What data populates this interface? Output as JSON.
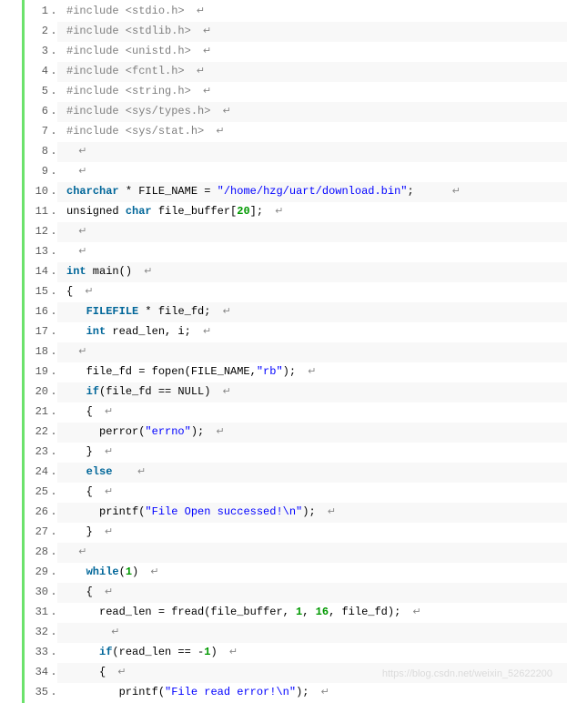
{
  "watermark": "https://blog.csdn.net/weixin_52622200",
  "return_glyph": "↵",
  "lines": [
    {
      "n": 1,
      "tokens": [
        {
          "t": "#include <stdio.h>",
          "c": "pp"
        }
      ]
    },
    {
      "n": 2,
      "tokens": [
        {
          "t": "#include <stdlib.h>",
          "c": "pp"
        }
      ]
    },
    {
      "n": 3,
      "tokens": [
        {
          "t": "#include <unistd.h>",
          "c": "pp"
        }
      ]
    },
    {
      "n": 4,
      "tokens": [
        {
          "t": "#include <fcntl.h>",
          "c": "pp"
        }
      ]
    },
    {
      "n": 5,
      "tokens": [
        {
          "t": "#include <string.h>",
          "c": "pp"
        }
      ]
    },
    {
      "n": 6,
      "tokens": [
        {
          "t": "#include <sys/types.h>",
          "c": "pp"
        }
      ]
    },
    {
      "n": 7,
      "tokens": [
        {
          "t": "#include <sys/stat.h>",
          "c": "pp"
        }
      ]
    },
    {
      "n": 8,
      "tokens": []
    },
    {
      "n": 9,
      "tokens": []
    },
    {
      "n": 10,
      "tokens": [
        {
          "t": "char",
          "c": "kw"
        },
        {
          "t": "char",
          "c": "kw"
        },
        {
          "t": " * FILE_NAME = ",
          "c": ""
        },
        {
          "t": "\"/home/hzg/uart/download.bin\"",
          "c": "str"
        },
        {
          "t": ";    ",
          "c": ""
        }
      ]
    },
    {
      "n": 11,
      "tokens": [
        {
          "t": "unsigned ",
          "c": ""
        },
        {
          "t": "char",
          "c": "kw"
        },
        {
          "t": " file_buffer[",
          "c": ""
        },
        {
          "t": "20",
          "c": "num"
        },
        {
          "t": "];",
          "c": ""
        }
      ]
    },
    {
      "n": 12,
      "tokens": []
    },
    {
      "n": 13,
      "tokens": []
    },
    {
      "n": 14,
      "tokens": [
        {
          "t": "int",
          "c": "kw"
        },
        {
          "t": " main()",
          "c": ""
        }
      ]
    },
    {
      "n": 15,
      "tokens": [
        {
          "t": "{",
          "c": ""
        }
      ]
    },
    {
      "n": 16,
      "tokens": [
        {
          "t": "   ",
          "c": ""
        },
        {
          "t": "FILE",
          "c": "kw"
        },
        {
          "t": "FILE",
          "c": "kw"
        },
        {
          "t": " * file_fd;",
          "c": ""
        }
      ]
    },
    {
      "n": 17,
      "tokens": [
        {
          "t": "   ",
          "c": ""
        },
        {
          "t": "int",
          "c": "kw"
        },
        {
          "t": " read_len, i;",
          "c": ""
        }
      ]
    },
    {
      "n": 18,
      "tokens": []
    },
    {
      "n": 19,
      "tokens": [
        {
          "t": "   file_fd = fopen(FILE_NAME,",
          "c": ""
        },
        {
          "t": "\"rb\"",
          "c": "str"
        },
        {
          "t": ");",
          "c": ""
        }
      ]
    },
    {
      "n": 20,
      "tokens": [
        {
          "t": "   ",
          "c": ""
        },
        {
          "t": "if",
          "c": "kw"
        },
        {
          "t": "(file_fd == NULL)",
          "c": ""
        }
      ]
    },
    {
      "n": 21,
      "tokens": [
        {
          "t": "   {",
          "c": ""
        }
      ]
    },
    {
      "n": 22,
      "tokens": [
        {
          "t": "     perror(",
          "c": ""
        },
        {
          "t": "\"errno\"",
          "c": "str"
        },
        {
          "t": ");",
          "c": ""
        }
      ]
    },
    {
      "n": 23,
      "tokens": [
        {
          "t": "   }",
          "c": ""
        }
      ]
    },
    {
      "n": 24,
      "tokens": [
        {
          "t": "   ",
          "c": ""
        },
        {
          "t": "else",
          "c": "kw"
        },
        {
          "t": "  ",
          "c": ""
        }
      ]
    },
    {
      "n": 25,
      "tokens": [
        {
          "t": "   {",
          "c": ""
        }
      ]
    },
    {
      "n": 26,
      "tokens": [
        {
          "t": "     printf(",
          "c": ""
        },
        {
          "t": "\"File Open successed!\\n\"",
          "c": "str"
        },
        {
          "t": ");",
          "c": ""
        }
      ]
    },
    {
      "n": 27,
      "tokens": [
        {
          "t": "   }",
          "c": ""
        }
      ]
    },
    {
      "n": 28,
      "tokens": []
    },
    {
      "n": 29,
      "tokens": [
        {
          "t": "   ",
          "c": ""
        },
        {
          "t": "while",
          "c": "kw"
        },
        {
          "t": "(",
          "c": ""
        },
        {
          "t": "1",
          "c": "num"
        },
        {
          "t": ")",
          "c": ""
        }
      ]
    },
    {
      "n": 30,
      "tokens": [
        {
          "t": "   {",
          "c": ""
        }
      ]
    },
    {
      "n": 31,
      "tokens": [
        {
          "t": "     read_len = fread(file_buffer, ",
          "c": ""
        },
        {
          "t": "1",
          "c": "num"
        },
        {
          "t": ", ",
          "c": ""
        },
        {
          "t": "16",
          "c": "num"
        },
        {
          "t": ", file_fd);",
          "c": ""
        }
      ]
    },
    {
      "n": 32,
      "tokens": [
        {
          "t": "     ",
          "c": ""
        }
      ]
    },
    {
      "n": 33,
      "tokens": [
        {
          "t": "     ",
          "c": ""
        },
        {
          "t": "if",
          "c": "kw"
        },
        {
          "t": "(read_len == -",
          "c": ""
        },
        {
          "t": "1",
          "c": "num"
        },
        {
          "t": ")",
          "c": ""
        }
      ]
    },
    {
      "n": 34,
      "tokens": [
        {
          "t": "     {",
          "c": ""
        }
      ]
    },
    {
      "n": 35,
      "tokens": [
        {
          "t": "        printf(",
          "c": ""
        },
        {
          "t": "\"File read error!\\n\"",
          "c": "str"
        },
        {
          "t": ");",
          "c": ""
        }
      ]
    }
  ]
}
